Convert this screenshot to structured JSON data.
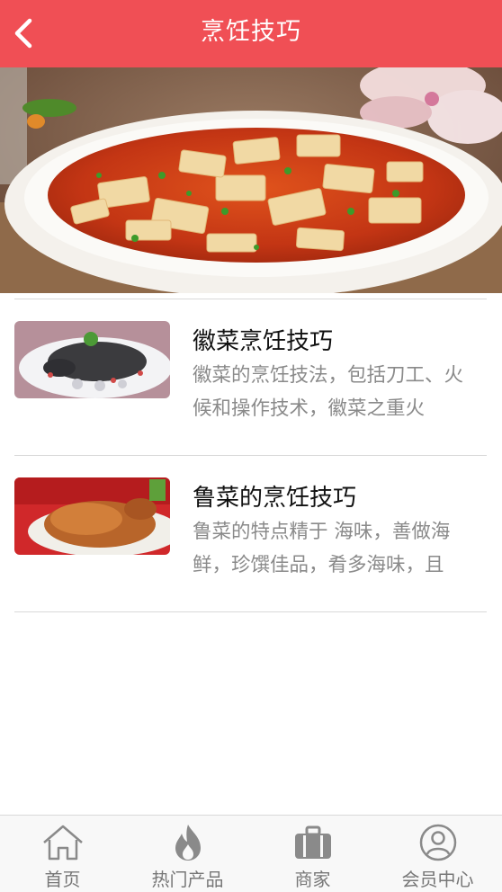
{
  "header": {
    "title": "烹饪技巧",
    "back_icon": "chevron-left-icon",
    "color": "#f04f55"
  },
  "articles": [
    {
      "title": "徽菜烹饪技巧",
      "desc": "徽菜的烹饪技法，包括刀工、火候和操作技术，徽菜之重火"
    },
    {
      "title": "鲁菜的烹饪技巧",
      "desc": "鲁菜的特点精于 海味，善做海鲜，珍馔佳品，肴多海味，且"
    }
  ],
  "tabs": [
    {
      "label": "首页",
      "icon": "home-icon"
    },
    {
      "label": "热门产品",
      "icon": "flame-icon"
    },
    {
      "label": "商家",
      "icon": "briefcase-icon"
    },
    {
      "label": "会员中心",
      "icon": "user-icon"
    }
  ]
}
